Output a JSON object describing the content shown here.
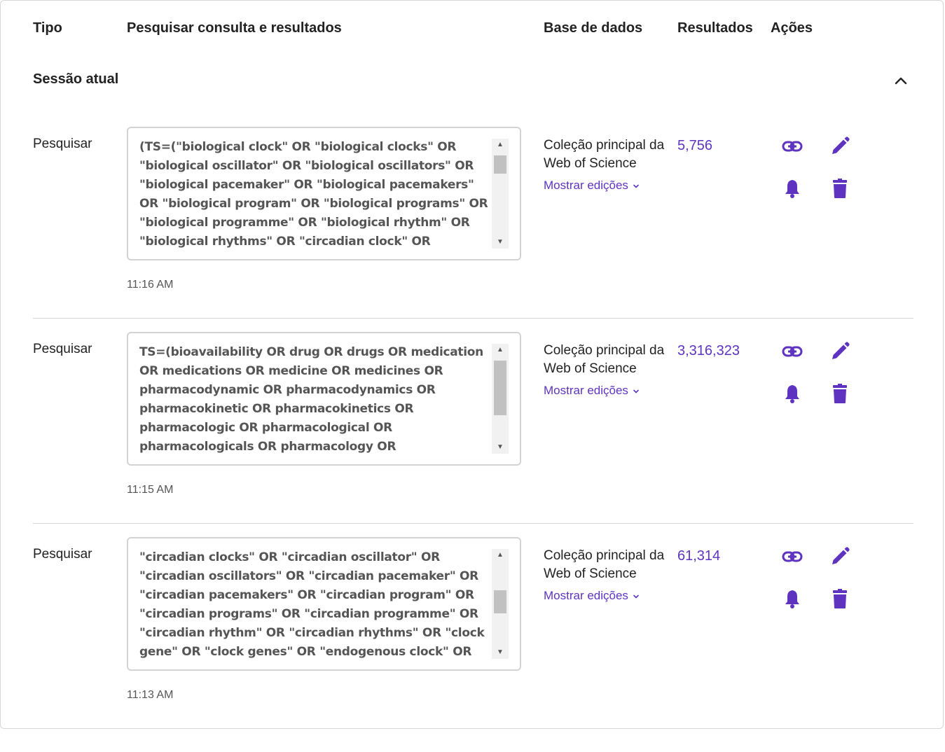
{
  "headers": {
    "type": "Tipo",
    "query": "Pesquisar consulta e resultados",
    "database": "Base de dados",
    "results": "Resultados",
    "actions": "Ações"
  },
  "session": {
    "title": "Sessão atual",
    "collapse_icon": "chevron-up-icon"
  },
  "accent_color": "#5e33bf",
  "rows": [
    {
      "type": "Pesquisar",
      "query": "(TS=(\"biological clock\" OR \"biological clocks\" OR \"biological oscillator\" OR \"biological oscillators\" OR \"biological pacemaker\" OR \"biological pacemakers\" OR \"biological program\" OR \"biological programs\" OR \"biological programme\" OR \"biological rhythm\" OR \"biological rhythms\" OR \"circadian clock\" OR",
      "timestamp": "11:16 AM",
      "database": "Coleção principal da Web of Science",
      "editions": "Mostrar edições",
      "results": "5,756",
      "scroll_position": 0.0
    },
    {
      "type": "Pesquisar",
      "query": "TS=(bioavailability OR drug OR drugs OR medication OR medications OR medicine OR medicines OR pharmacodynamic OR pharmacodynamics OR pharmacokinetic OR pharmacokinetics OR pharmacologic OR pharmacological OR pharmacologicals OR pharmacology OR",
      "timestamp": "11:15 AM",
      "database": "Coleção principal da Web of Science",
      "editions": "Mostrar edições",
      "results": "3,316,323",
      "scroll_position": 0.0
    },
    {
      "type": "Pesquisar",
      "query": "\"circadian clocks\" OR \"circadian oscillator\" OR \"circadian oscillators\" OR \"circadian pacemaker\" OR \"circadian pacemakers\" OR \"circadian program\" OR \"circadian programs\" OR \"circadian programme\" OR \"circadian rhythm\" OR \"circadian rhythms\" OR \"clock gene\" OR \"clock genes\" OR \"endogenous clock\" OR",
      "timestamp": "11:13 AM",
      "database": "Coleção principal da Web of Science",
      "editions": "Mostrar edições",
      "results": "61,314",
      "scroll_position": 0.45
    }
  ],
  "action_icons": [
    "link-icon",
    "edit-icon",
    "alert-bell-icon",
    "delete-icon"
  ]
}
